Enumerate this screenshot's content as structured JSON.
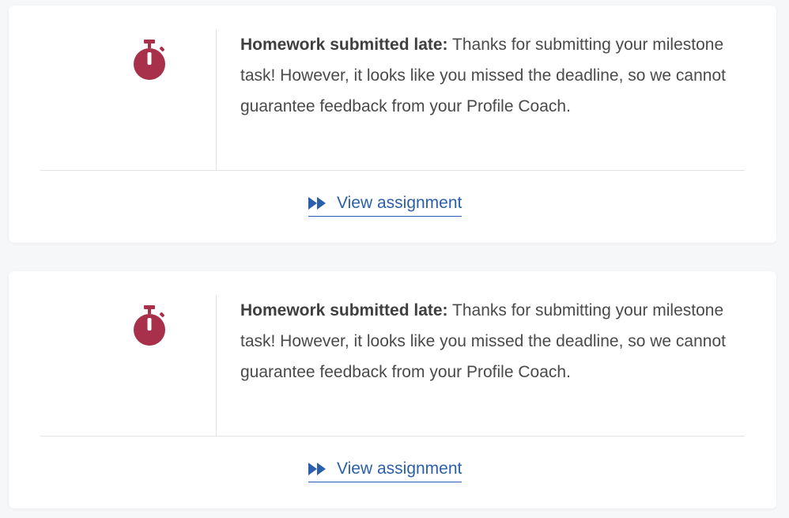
{
  "colors": {
    "icon": "#a8304a",
    "link": "#2b5fad",
    "text": "#4a4a4a",
    "background": "#f6f7f9",
    "card": "#ffffff"
  },
  "notifications": [
    {
      "icon": "stopwatch-icon",
      "label": "Homework submitted late:",
      "message": " Thanks for submitting your milestone task! However, it looks like you missed the deadline, so we cannot guarantee feedback from your Profile Coach.",
      "link_icon": "fast-forward-icon",
      "link_text": "View assignment"
    },
    {
      "icon": "stopwatch-icon",
      "label": "Homework submitted late:",
      "message": " Thanks for submitting your milestone task! However, it looks like you missed the deadline, so we cannot guarantee feedback from your Profile Coach.",
      "link_icon": "fast-forward-icon",
      "link_text": "View assignment"
    }
  ]
}
